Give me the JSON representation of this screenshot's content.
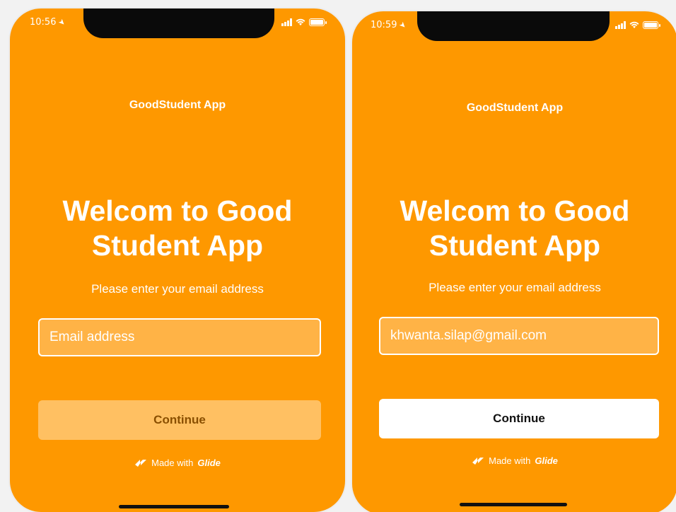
{
  "screens": [
    {
      "status": {
        "time": "10:56"
      },
      "app_title": "GoodStudent App",
      "welcome_line1": "Welcom to Good",
      "welcome_line2": "Student App",
      "subtitle": "Please enter your email address",
      "email": {
        "value": "",
        "placeholder": "Email address"
      },
      "continue_label": "Continue",
      "continue_state": "disabled",
      "footer": {
        "made_with": "Made with",
        "brand": "Glide"
      }
    },
    {
      "status": {
        "time": "10:59"
      },
      "app_title": "GoodStudent App",
      "welcome_line1": "Welcom to Good",
      "welcome_line2": "Student App",
      "subtitle": "Please enter your email address",
      "email": {
        "value": "khwanta.silap@gmail.com",
        "placeholder": "Email address"
      },
      "continue_label": "Continue",
      "continue_state": "enabled",
      "footer": {
        "made_with": "Made with",
        "brand": "Glide"
      }
    }
  ],
  "colors": {
    "background": "#fe9800",
    "input_fill": "#ffb346",
    "button_disabled": "#ffc062",
    "button_enabled": "#ffffff"
  },
  "icons": [
    "location-arrow-icon",
    "signal-icon",
    "wifi-icon",
    "battery-icon",
    "glide-logo-icon"
  ]
}
